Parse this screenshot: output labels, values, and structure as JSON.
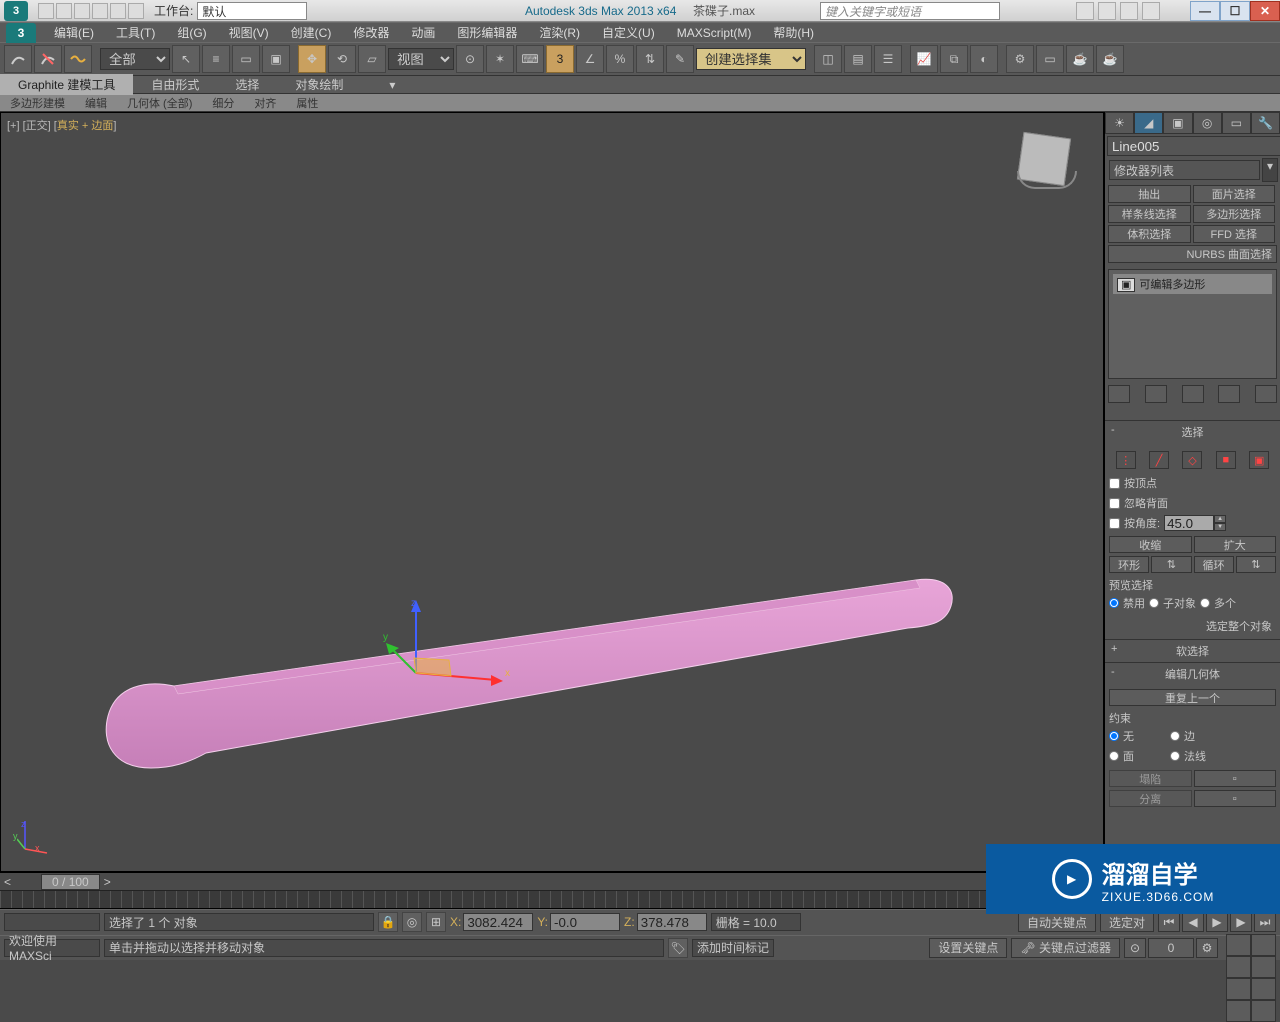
{
  "titlebar": {
    "workspace_label": "工作台:",
    "workspace_value": "默认",
    "app_title": "Autodesk 3ds Max  2013 x64",
    "file_title": "茶碟子.max",
    "search_placeholder": "键入关键字或短语"
  },
  "menubar": {
    "items": [
      "编辑(E)",
      "工具(T)",
      "组(G)",
      "视图(V)",
      "创建(C)",
      "修改器",
      "动画",
      "图形编辑器",
      "渲染(R)",
      "自定义(U)",
      "MAXScript(M)",
      "帮助(H)"
    ]
  },
  "main_toolbar": {
    "filter_all": "全部",
    "view_dropdown": "视图",
    "named_sel": "创建选择集"
  },
  "ribbon": {
    "tabs": [
      "Graphite 建模工具",
      "自由形式",
      "选择",
      "对象绘制"
    ],
    "subtabs": [
      "多边形建模",
      "编辑",
      "几何体 (全部)",
      "细分",
      "对齐",
      "属性"
    ]
  },
  "viewport": {
    "label_prefix": "[+] [正交] [",
    "label_shaded": "真实",
    "label_plus": " + ",
    "label_edges": "边面",
    "label_suffix": "]"
  },
  "cmd_panel": {
    "object_name": "Line005",
    "modifier_list_label": "修改器列表",
    "mod_buttons": [
      "抽出",
      "面片选择",
      "样条线选择",
      "多边形选择",
      "体积选择",
      "FFD 选择",
      "NURBS 曲面选择"
    ],
    "stack_item": "可编辑多边形",
    "selection_title": "选择",
    "by_vertex": "按顶点",
    "ignore_back": "忽略背面",
    "by_angle": "按角度:",
    "angle_value": "45.0",
    "shrink": "收缩",
    "grow": "扩大",
    "ring": "环形",
    "loop": "循环",
    "preview_sel": "预览选择",
    "disable": "禁用",
    "subobj": "子对象",
    "multiple": "多个",
    "select_whole": "选定整个对象",
    "soft_sel_title": "软选择",
    "edit_geom_title": "编辑几何体",
    "repeat_last": "重复上一个",
    "constraint": "约束",
    "c_none": "无",
    "c_edge": "边",
    "c_face": "面",
    "c_normal": "法线",
    "collapse": "塌陷",
    "detach": "分离"
  },
  "timeline": {
    "slider_label": "0 / 100"
  },
  "status": {
    "script_hint": "欢迎使用 MAXSci",
    "prompt1": "选择了 1 个 对象",
    "prompt2": "单击并拖动以选择并移动对象",
    "x_label": "X:",
    "x_val": "3082.424",
    "y_label": "Y:",
    "y_val": "-0.0",
    "z_label": "Z:",
    "z_val": "378.478",
    "grid": "栅格 = 10.0",
    "auto_key": "自动关键点",
    "set_key": "设置关键点",
    "selected": "选定对",
    "key_filters": "关键点过滤器",
    "add_time_tag": "添加时间标记"
  },
  "watermark": {
    "line1": "溜溜自学",
    "line2": "ZIXUE.3D66.COM"
  }
}
